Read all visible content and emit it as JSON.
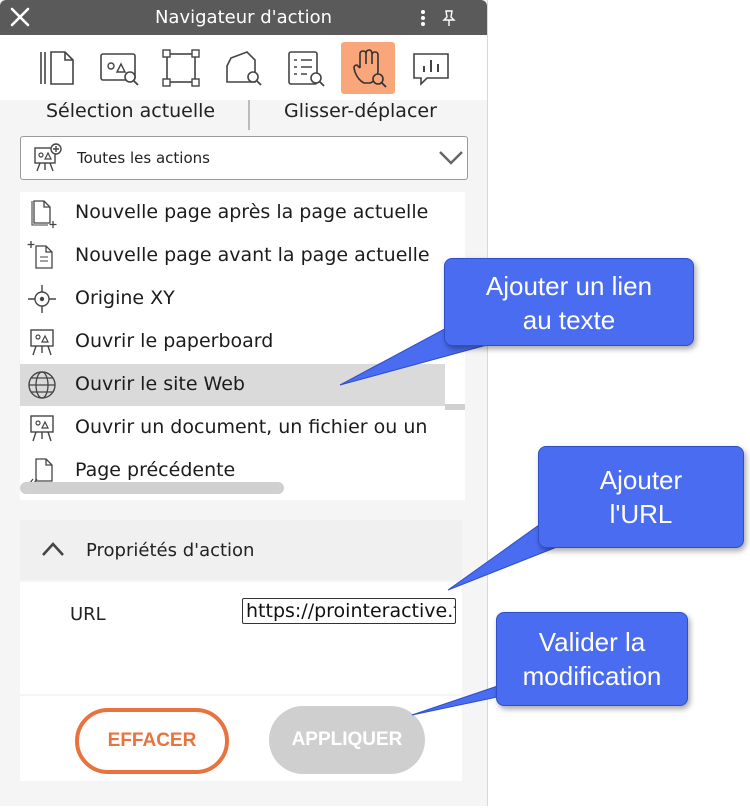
{
  "window": {
    "title": "Navigateur d'action"
  },
  "tabs": [
    "Sélection actuelle",
    "Glisser-déplacer"
  ],
  "dropdown": {
    "value": "Toutes les actions"
  },
  "toolbar": {
    "active_tool": "drag-drop-hand-icon",
    "icons": [
      "page-icon",
      "image-search-icon",
      "selection-rect-icon",
      "shape-search-icon",
      "list-search-icon",
      "drag-drop-hand-icon",
      "chart-comment-icon"
    ],
    "active_color": "#f9a67a"
  },
  "actions": [
    {
      "label": "Nouvelle page après la page actuelle",
      "icon": "page-after-icon"
    },
    {
      "label": "Nouvelle page avant la page actuelle",
      "icon": "page-before-icon"
    },
    {
      "label": "Origine XY",
      "icon": "crosshair-icon"
    },
    {
      "label": "Ouvrir le paperboard",
      "icon": "flipchart-icon"
    },
    {
      "label": "Ouvrir le site Web",
      "icon": "globe-icon",
      "selected": true
    },
    {
      "label": "Ouvrir un document, un fichier ou un",
      "icon": "flipchart-icon"
    },
    {
      "label": "Page précédente",
      "icon": "page-previous-icon"
    }
  ],
  "properties": {
    "header": "Propriétés d'action",
    "url_label": "URL",
    "url_value": "https://prointeractive.f"
  },
  "buttons": {
    "clear": "EFFACER",
    "apply": "APPLIQUER"
  },
  "callouts": {
    "link": [
      "Ajouter un lien",
      "au texte"
    ],
    "url": [
      "Ajouter",
      "l'URL"
    ],
    "validate": [
      "Valider la",
      "modification"
    ]
  },
  "colors": {
    "accent": "#e8733f",
    "callout": "#4a6cf0",
    "titlebar": "#5a5a5a",
    "disabled": "#cfcfcf"
  }
}
